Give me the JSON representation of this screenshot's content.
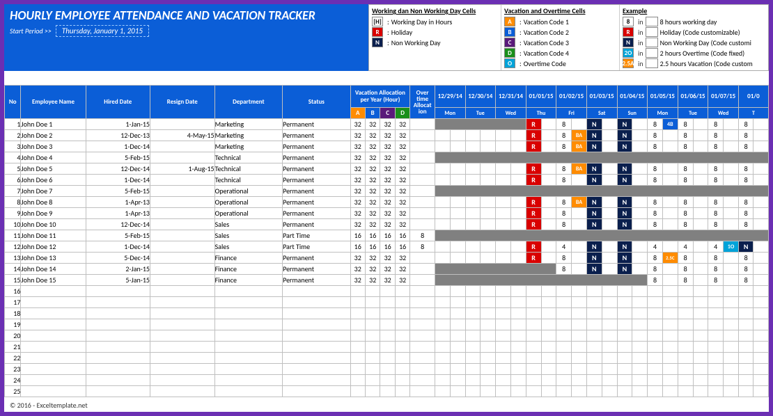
{
  "header": {
    "title": "HOURLY EMPLOYEE ATTENDANCE AND VACATION TRACKER",
    "start_label": "Start Period >>",
    "start_date": "Thursday, January 1, 2015"
  },
  "legend1": {
    "title": "Working dan Non Working Day Cells",
    "rows": [
      {
        "chip": "[H]",
        "cls": "H",
        "txt": "Working Day in Hours"
      },
      {
        "chip": "R",
        "cls": "R",
        "txt": "Holiday"
      },
      {
        "chip": "N",
        "cls": "N",
        "txt": "Non Working Day"
      }
    ]
  },
  "legend2": {
    "title": "Vacation and Overtime Cells",
    "rows": [
      {
        "chip": "A",
        "cls": "A",
        "txt": "Vacation Code 1"
      },
      {
        "chip": "B",
        "cls": "B",
        "txt": "Vacation Code 2"
      },
      {
        "chip": "C",
        "cls": "C",
        "txt": "Vacation Code 3"
      },
      {
        "chip": "D",
        "cls": "D",
        "txt": "Vacation Code 4"
      },
      {
        "chip": "O",
        "cls": "O",
        "txt": "Overtime Code"
      }
    ]
  },
  "legend3": {
    "title": "Example",
    "rows": [
      {
        "chip": "8",
        "cls": "num",
        "txt": "8 hours working day"
      },
      {
        "chip": "R",
        "cls": "R",
        "txt": "Holiday (Code customizable)"
      },
      {
        "chip": "N",
        "cls": "N",
        "txt": "Non Working Day (Code customi"
      },
      {
        "chip": "2O",
        "cls": "O",
        "txt": "2 hours Overtime (Code fixed)"
      },
      {
        "chip": "2.5A",
        "cls": "A",
        "txt": "2.5 hours Vacation (Code custom"
      }
    ]
  },
  "cols": {
    "no": "No",
    "emp": "Employee Name",
    "hired": "Hired Date",
    "resign": "Resign Date",
    "dept": "Department",
    "status": "Status",
    "vac": "Vacation Allocation per Year (Hour)",
    "ot": "Over time Allocat ion"
  },
  "dates": [
    {
      "d": "12/29/14",
      "w": "Mon"
    },
    {
      "d": "12/30/14",
      "w": "Tue"
    },
    {
      "d": "12/31/14",
      "w": "Wed"
    },
    {
      "d": "01/01/15",
      "w": "Thu"
    },
    {
      "d": "01/02/15",
      "w": "Fri"
    },
    {
      "d": "01/03/15",
      "w": "Sat"
    },
    {
      "d": "01/04/15",
      "w": "Sun"
    },
    {
      "d": "01/05/15",
      "w": "Mon"
    },
    {
      "d": "01/06/15",
      "w": "Tue"
    },
    {
      "d": "01/07/15",
      "w": "Wed"
    },
    {
      "d": "01/0",
      "w": "T"
    }
  ],
  "rows": [
    {
      "no": 1,
      "name": "John Doe 1",
      "hired": "1-Jan-15",
      "resign": "",
      "dept": "Marketing",
      "status": "Permanent",
      "va": [
        32,
        32,
        32,
        32
      ],
      "ot": "",
      "grey": 3,
      "cells": [
        "R",
        "",
        "8",
        "",
        "N",
        "",
        "N",
        "",
        "8",
        "4B",
        "8",
        "",
        "8",
        "",
        "8"
      ]
    },
    {
      "no": 2,
      "name": "John Doe 2",
      "hired": "12-Dec-13",
      "resign": "4-May-15",
      "dept": "Marketing",
      "status": "Permanent",
      "va": [
        32,
        32,
        32,
        32
      ],
      "ot": "",
      "grey": 0,
      "cells": [
        "",
        "",
        "",
        "",
        "",
        "",
        "R",
        "",
        "8",
        "BA",
        "N",
        "",
        "N",
        "",
        "8",
        "",
        "8",
        "",
        "8",
        "",
        "8"
      ]
    },
    {
      "no": 3,
      "name": "John Doe 3",
      "hired": "1-Dec-14",
      "resign": "",
      "dept": "Marketing",
      "status": "Permanent",
      "va": [
        32,
        32,
        32,
        32
      ],
      "ot": "",
      "grey": 0,
      "cells": [
        "",
        "",
        "",
        "",
        "",
        "",
        "R",
        "",
        "8",
        "BA",
        "N",
        "",
        "N",
        "",
        "8",
        "",
        "8",
        "",
        "8",
        "",
        "8"
      ]
    },
    {
      "no": 4,
      "name": "John Doe 4",
      "hired": "5-Feb-15",
      "resign": "",
      "dept": "Technical",
      "status": "Permanent",
      "va": [
        32,
        32,
        32,
        32
      ],
      "ot": "",
      "grey": 11,
      "cells": []
    },
    {
      "no": 5,
      "name": "John Doe 5",
      "hired": "12-Dec-14",
      "resign": "1-Aug-15",
      "dept": "Technical",
      "status": "Permanent",
      "va": [
        32,
        32,
        32,
        32
      ],
      "ot": "",
      "grey": 0,
      "cells": [
        "",
        "",
        "",
        "",
        "",
        "",
        "R",
        "",
        "8",
        "BA",
        "N",
        "",
        "N",
        "",
        "8",
        "",
        "8",
        "",
        "8",
        "",
        "8"
      ]
    },
    {
      "no": 6,
      "name": "John Doe 6",
      "hired": "1-Dec-14",
      "resign": "",
      "dept": "Technical",
      "status": "Permanent",
      "va": [
        32,
        32,
        32,
        32
      ],
      "ot": "",
      "grey": 0,
      "cells": [
        "",
        "",
        "",
        "",
        "",
        "",
        "R",
        "",
        "8",
        "",
        "N",
        "",
        "N",
        "",
        "8",
        "",
        "8",
        "",
        "8",
        "",
        "8"
      ]
    },
    {
      "no": 7,
      "name": "John Doe 7",
      "hired": "5-Feb-15",
      "resign": "",
      "dept": "Operational",
      "status": "Permanent",
      "va": [
        32,
        32,
        32,
        32
      ],
      "ot": "",
      "grey": 11,
      "cells": []
    },
    {
      "no": 8,
      "name": "John Doe 8",
      "hired": "1-Apr-13",
      "resign": "",
      "dept": "Operational",
      "status": "Permanent",
      "va": [
        32,
        32,
        32,
        32
      ],
      "ot": "",
      "grey": 0,
      "cells": [
        "",
        "",
        "",
        "",
        "",
        "",
        "R",
        "",
        "8",
        "BA",
        "N",
        "",
        "N",
        "",
        "8",
        "",
        "8",
        "",
        "8",
        "",
        "8"
      ]
    },
    {
      "no": 9,
      "name": "John Doe 9",
      "hired": "1-Apr-13",
      "resign": "",
      "dept": "Operational",
      "status": "Permanent",
      "va": [
        32,
        32,
        32,
        32
      ],
      "ot": "",
      "grey": 0,
      "cells": [
        "",
        "",
        "",
        "",
        "",
        "",
        "R",
        "",
        "8",
        "",
        "N",
        "",
        "N",
        "",
        "8",
        "",
        "8",
        "",
        "8",
        "",
        "8"
      ]
    },
    {
      "no": 10,
      "name": "John Doe 10",
      "hired": "12-Dec-14",
      "resign": "",
      "dept": "Sales",
      "status": "Permanent",
      "va": [
        32,
        32,
        32,
        32
      ],
      "ot": "",
      "grey": 0,
      "cells": [
        "",
        "",
        "",
        "",
        "",
        "",
        "R",
        "",
        "8",
        "",
        "N",
        "",
        "N",
        "",
        "8",
        "",
        "8",
        "",
        "8",
        "",
        "8"
      ]
    },
    {
      "no": 11,
      "name": "John Doe 11",
      "hired": "5-Feb-15",
      "resign": "",
      "dept": "Sales",
      "status": "Part Time",
      "va": [
        16,
        16,
        16,
        16
      ],
      "ot": "8",
      "grey": 11,
      "cells": []
    },
    {
      "no": 12,
      "name": "John Doe 12",
      "hired": "1-Dec-14",
      "resign": "",
      "dept": "Sales",
      "status": "Part Time",
      "va": [
        16,
        16,
        16,
        16
      ],
      "ot": "8",
      "grey": 0,
      "cells": [
        "",
        "",
        "",
        "",
        "",
        "",
        "R",
        "",
        "4",
        "",
        "N",
        "",
        "N",
        "",
        "4",
        "",
        "4",
        "",
        "4",
        "1O",
        "N"
      ]
    },
    {
      "no": 13,
      "name": "John Doe 13",
      "hired": "5-Dec-14",
      "resign": "",
      "dept": "Finance",
      "status": "Permanent",
      "va": [
        32,
        32,
        32,
        32
      ],
      "ot": "",
      "grey": 0,
      "cells": [
        "",
        "",
        "",
        "",
        "",
        "",
        "R",
        "",
        "8",
        "",
        "N",
        "",
        "N",
        "",
        "8",
        "2.5C",
        "8",
        "",
        "8",
        "",
        "8"
      ]
    },
    {
      "no": 14,
      "name": "John Doe 14",
      "hired": "2-Jan-15",
      "resign": "",
      "dept": "Finance",
      "status": "Permanent",
      "va": [
        32,
        32,
        32,
        32
      ],
      "ot": "",
      "grey": 4,
      "cells": [
        "8",
        "",
        "N",
        "",
        "N",
        "",
        "8",
        "",
        "8",
        "",
        "8",
        "",
        "8"
      ]
    },
    {
      "no": 15,
      "name": "John Doe 15",
      "hired": "5-Jan-15",
      "resign": "",
      "dept": "Finance",
      "status": "Permanent",
      "va": [
        32,
        32,
        32,
        32
      ],
      "ot": "",
      "grey": 7,
      "cells": [
        "8",
        "",
        "8",
        "",
        "8",
        "",
        "8"
      ]
    }
  ],
  "emptyrows": [
    16,
    17,
    18,
    19,
    20,
    21,
    22,
    23,
    24,
    25
  ],
  "footer": "© 2016 - Exceltemplate.net"
}
